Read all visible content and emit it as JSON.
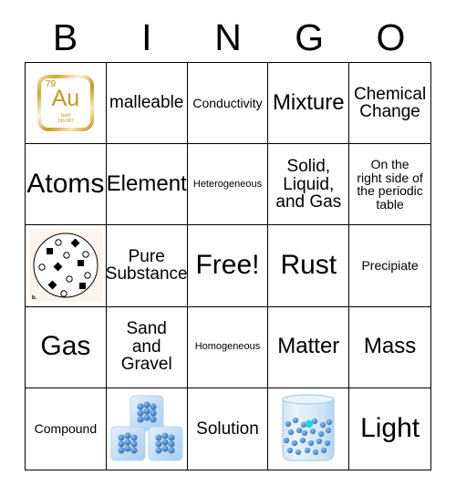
{
  "header": {
    "letters": [
      "B",
      "I",
      "N",
      "G",
      "O"
    ]
  },
  "grid": {
    "columns": 5,
    "rows": 5,
    "cells": [
      {
        "id": "b1",
        "type": "image",
        "image": "periodic-element-gold-tile",
        "element": {
          "atomic_number": "79",
          "symbol": "Au",
          "name": "Gold",
          "atomic_mass": "196.967"
        }
      },
      {
        "id": "i1",
        "type": "text",
        "text": "malleable",
        "size": "md"
      },
      {
        "id": "n1",
        "type": "text",
        "text": "Conductivity",
        "size": "sm"
      },
      {
        "id": "g1",
        "type": "text",
        "text": "Mixture",
        "size": "lg"
      },
      {
        "id": "o1",
        "type": "text",
        "text": "Chemical\nChange",
        "size": "md"
      },
      {
        "id": "b2",
        "type": "text",
        "text": "Atoms",
        "size": "xl"
      },
      {
        "id": "i2",
        "type": "text",
        "text": "Element",
        "size": "lg"
      },
      {
        "id": "n2",
        "type": "text",
        "text": "Heterogeneous",
        "size": "xs"
      },
      {
        "id": "g2",
        "type": "text",
        "text": "Solid,\nLiquid,\nand Gas",
        "size": "md"
      },
      {
        "id": "o2",
        "type": "text",
        "text": "On the\nright side of\nthe periodic\ntable",
        "size": "sm"
      },
      {
        "id": "b3",
        "type": "image",
        "image": "heterogeneous-mixture-particle-diagram",
        "figure_label": "b."
      },
      {
        "id": "i3",
        "type": "text",
        "text": "Pure\nSubstance",
        "size": "md"
      },
      {
        "id": "n3",
        "type": "text",
        "text": "Free!",
        "size": "xl"
      },
      {
        "id": "g3",
        "type": "text",
        "text": "Rust",
        "size": "xl"
      },
      {
        "id": "o3",
        "type": "text",
        "text": "Precipiate",
        "size": "sm"
      },
      {
        "id": "b4",
        "type": "text",
        "text": "Gas",
        "size": "xl"
      },
      {
        "id": "i4",
        "type": "text",
        "text": "Sand\nand\nGravel",
        "size": "md"
      },
      {
        "id": "n4",
        "type": "text",
        "text": "Homogeneous",
        "size": "xs"
      },
      {
        "id": "g4",
        "type": "text",
        "text": "Matter",
        "size": "lg"
      },
      {
        "id": "o4",
        "type": "text",
        "text": "Mass",
        "size": "lg"
      },
      {
        "id": "b5",
        "type": "text",
        "text": "Compound",
        "size": "sm"
      },
      {
        "id": "i5",
        "type": "image",
        "image": "ice-cubes-solid-state-illustration"
      },
      {
        "id": "n5",
        "type": "text",
        "text": "Solution",
        "size": "md"
      },
      {
        "id": "g5",
        "type": "image",
        "image": "beaker-with-particles-illustration"
      },
      {
        "id": "o5",
        "type": "text",
        "text": "Light",
        "size": "xl"
      }
    ]
  },
  "colors": {
    "border": "#000000",
    "background": "#ffffff",
    "text": "#000000",
    "gold_tile": "#c9971f",
    "ice_blue": "#bcd9f2",
    "particle_blue": "#4a86c8",
    "highlight_cyan": "#22d3ee"
  }
}
